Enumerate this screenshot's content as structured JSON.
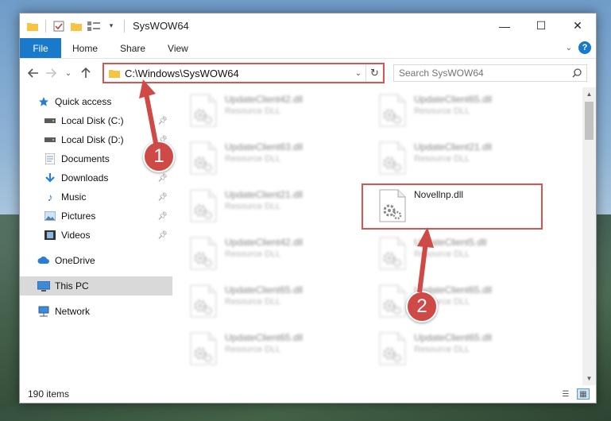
{
  "window": {
    "title": "SysWOW64",
    "controls": {
      "minimize": "—",
      "maximize": "☐",
      "close": "✕"
    }
  },
  "ribbon": {
    "tabs": [
      "File",
      "Home",
      "Share",
      "View"
    ]
  },
  "nav": {
    "address_path": "C:\\Windows\\SysWOW64",
    "search_placeholder": "Search SysWOW64"
  },
  "sidebar": {
    "quick_access": "Quick access",
    "items": [
      {
        "label": "Local Disk (C:)",
        "icon": "drive-icon",
        "pinned": true
      },
      {
        "label": "Local Disk (D:)",
        "icon": "drive-icon",
        "pinned": true
      },
      {
        "label": "Documents",
        "icon": "documents-icon",
        "pinned": false
      },
      {
        "label": "Downloads",
        "icon": "downloads-icon",
        "pinned": true
      },
      {
        "label": "Music",
        "icon": "music-icon",
        "pinned": true
      },
      {
        "label": "Pictures",
        "icon": "pictures-icon",
        "pinned": true
      },
      {
        "label": "Videos",
        "icon": "videos-icon",
        "pinned": true
      }
    ],
    "onedrive": "OneDrive",
    "this_pc": "This PC",
    "network": "Network"
  },
  "files": [
    {
      "name": "UpdateClient42.dll",
      "type": "Resource DLL",
      "blurred": true
    },
    {
      "name": "UpdateClient65.dll",
      "type": "Resource DLL",
      "blurred": true
    },
    {
      "name": "UpdateClient63.dll",
      "type": "Resource DLL",
      "blurred": true
    },
    {
      "name": "UpdateClient21.dll",
      "type": "Resource DLL",
      "blurred": true
    },
    {
      "name": "UpdateClient21.dll",
      "type": "Resource DLL",
      "blurred": true
    },
    {
      "name": "Novellnp.dll",
      "type": "",
      "blurred": false
    },
    {
      "name": "UpdateClient42.dll",
      "type": "Resource DLL",
      "blurred": true
    },
    {
      "name": "UpdateClient5.dll",
      "type": "Resource DLL",
      "blurred": true
    },
    {
      "name": "UpdateClient65.dll",
      "type": "Resource DLL",
      "blurred": true
    },
    {
      "name": "UpdateClient65.dll",
      "type": "Resource DLL",
      "blurred": true
    },
    {
      "name": "UpdateClient65.dll",
      "type": "Resource DLL",
      "blurred": true
    },
    {
      "name": "UpdateClient65.dll",
      "type": "Resource DLL",
      "blurred": true
    }
  ],
  "status": {
    "item_count": "190 items"
  },
  "callouts": [
    "1",
    "2"
  ],
  "colors": {
    "accent": "#1979ca",
    "highlight": "#d9534f",
    "callout": "#cf4a46"
  }
}
